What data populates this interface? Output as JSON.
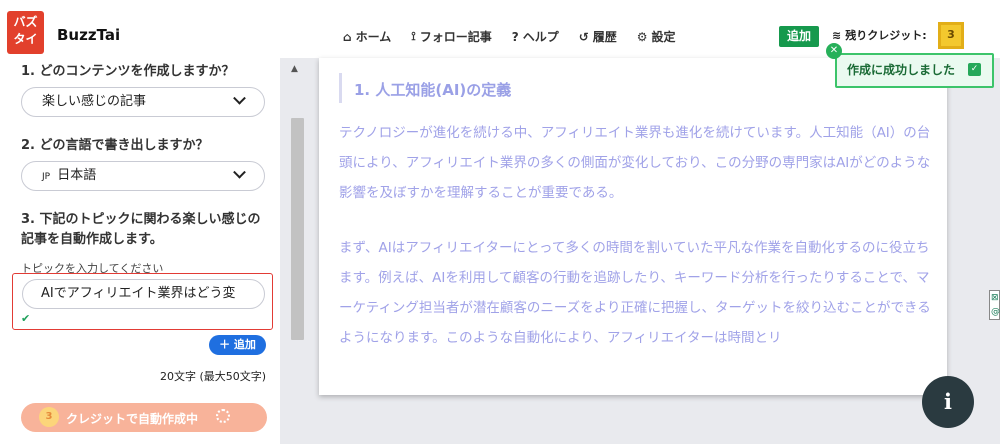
{
  "brand": {
    "logo_line1": "バズ",
    "logo_line2": "タイ",
    "name": "BuzzTai"
  },
  "nav": [
    {
      "label": "ホーム",
      "icon": "home-icon",
      "glyph": "⌂"
    },
    {
      "label": "フォロー記事",
      "icon": "rss-icon",
      "glyph": "⟟"
    },
    {
      "label": "ヘルプ",
      "icon": "help-icon",
      "glyph": "?"
    },
    {
      "label": "履歴",
      "icon": "history-icon",
      "glyph": "↺"
    },
    {
      "label": "設定",
      "icon": "gear-icon",
      "glyph": "⚙"
    }
  ],
  "header": {
    "add_label": "追加",
    "credit_label": "残りクレジット:",
    "credit_count": "3"
  },
  "toast": {
    "message": "作成に成功しました"
  },
  "form": {
    "q1": "1. どのコンテンツを作成しますか？",
    "q1_value": "楽しい感じの記事",
    "q2": "2. どの言語で書き出しますか？",
    "q2_flag": "JP",
    "q2_value": "日本語",
    "q3": "3. 下記のトピックに関わる楽しい感じの記事を自動作成します。",
    "topic_label": "トピックを入力してください",
    "topic_value": "AIでアフィリエイト業界はどう変",
    "add_topic": "＋ 追加",
    "char_count": "20文字 (最大50文字)",
    "generate_label": "クレジットで自動作成中",
    "generate_coin": "3"
  },
  "article": {
    "heading": "1. 人工知能(AI)の定義",
    "para1": "テクノロジーが進化を続ける中、アフィリエイト業界も進化を続けています。人工知能（AI）の台頭により、アフィリエイト業界の多くの側面が変化しており、この分野の専門家はAIがどのような影響を及ぼすかを理解することが重要である。",
    "para2": "まず、AIはアフィリエイターにとって多くの時間を割いていた平凡な作業を自動化するのに役立ちます。例えば、AIを利用して顧客の行動を追跡したり、キーワード分析を行ったりすることで、マーケティング担当者が潜在顧客のニーズをより正確に把握し、ターゲットを絞り込むことができるようになります。このような自動化により、アフィリエイターは時間とリ"
  },
  "colors": {
    "brand": "#e2402c",
    "add_green": "#16994d",
    "article_text": "#a0a2e8",
    "primary_blue": "#1f6fe0"
  }
}
